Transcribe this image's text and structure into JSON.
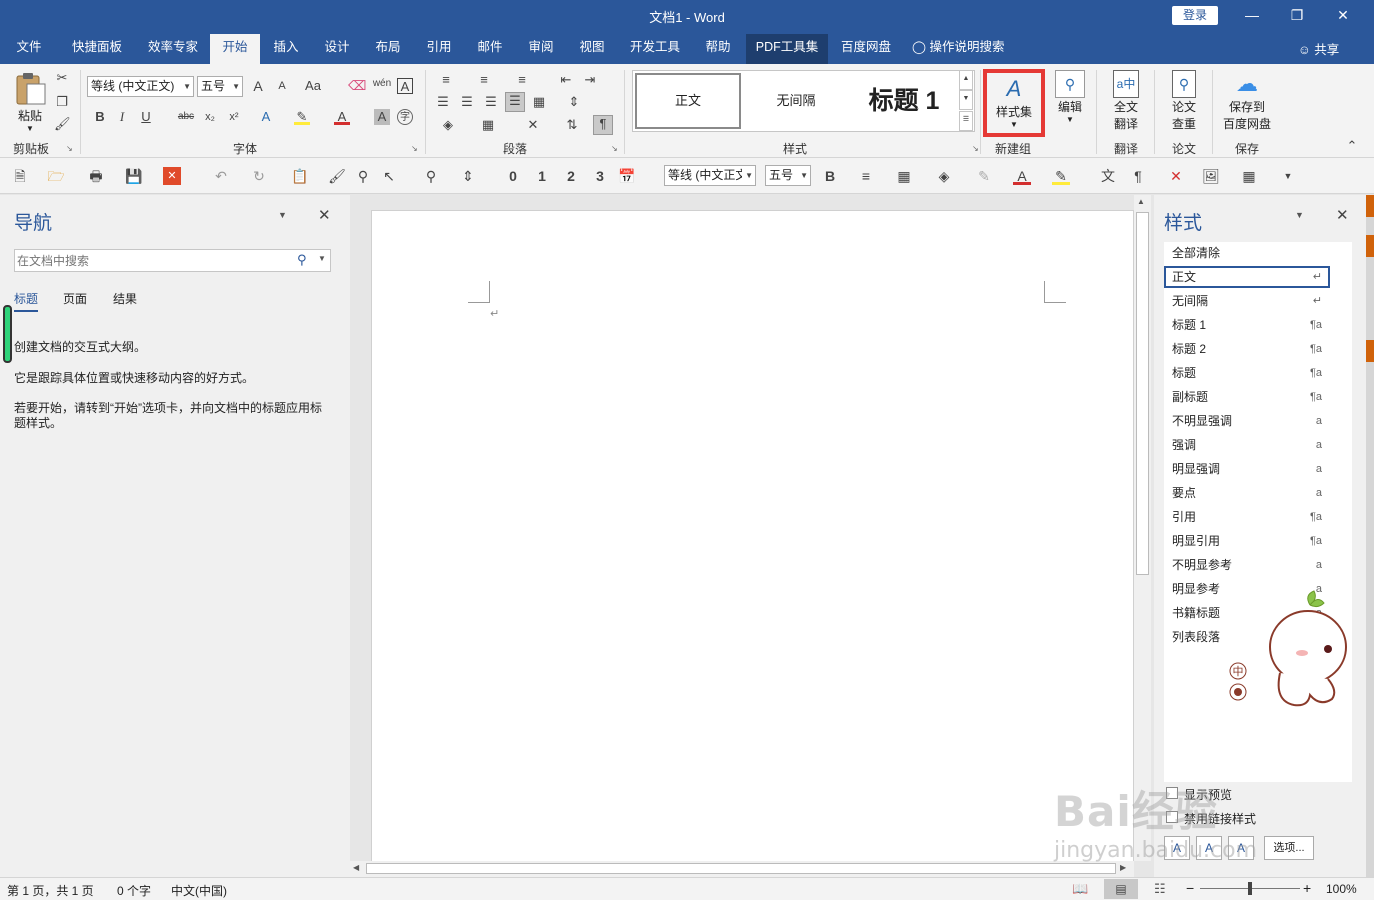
{
  "window": {
    "title": "文档1  -  Word",
    "login_label": "登录",
    "minimize": "—",
    "restore": "❐",
    "close": "✕"
  },
  "tabs": [
    "文件",
    "快捷面板",
    "效率专家",
    "开始",
    "插入",
    "设计",
    "布局",
    "引用",
    "邮件",
    "审阅",
    "视图",
    "开发工具",
    "帮助",
    "PDF工具集",
    "百度网盘",
    "操作说明搜索"
  ],
  "active_tab": "开始",
  "share_label": "共享",
  "ribbon": {
    "clipboard": {
      "paste_label": "粘贴",
      "group_label": "剪贴板"
    },
    "font": {
      "font_name": "等线 (中文正文)",
      "font_size": "五号",
      "group_label": "字体",
      "bold": "B",
      "italic": "I",
      "underline": "U",
      "strike": "abc",
      "sub": "x₂",
      "sup": "x²",
      "grow": "A",
      "shrink": "A",
      "case": "Aa",
      "phonetic": "wén",
      "border_char": "A",
      "shade_char": "A",
      "enclose": "字"
    },
    "paragraph": {
      "group_label": "段落"
    },
    "styles": {
      "items": [
        "正文",
        "无间隔",
        "标题 1"
      ],
      "group_label": "样式"
    },
    "new_group": {
      "style_set_label": "样式集",
      "edit_label": "编辑",
      "group_label": "新建组"
    },
    "translate": {
      "label_line1": "全文",
      "label_line2": "翻译",
      "group_label": "翻译"
    },
    "paper": {
      "label_line1": "论文",
      "label_line2": "查重",
      "group_label": "论文"
    },
    "save": {
      "label_line1": "保存到",
      "label_line2": "百度网盘",
      "group_label": "保存"
    },
    "highlight_color": "#e53935"
  },
  "qat": {
    "levels": [
      "0",
      "1",
      "2",
      "3"
    ],
    "font_name": "等线 (中文正文)",
    "font_size": "五号",
    "bold": "B"
  },
  "nav_pane": {
    "title": "导航",
    "search_placeholder": "在文档中搜索",
    "tabs": [
      "标题",
      "页面",
      "结果"
    ],
    "active_tab": "标题",
    "hints": [
      "创建文档的交互式大纲。",
      "它是跟踪具体位置或快速移动内容的好方式。",
      "若要开始，请转到“开始”选项卡，并向文档中的标题应用标题样式。"
    ]
  },
  "styles_pane": {
    "title": "样式",
    "items": [
      {
        "name": "全部清除",
        "mark": ""
      },
      {
        "name": "正文",
        "mark": "↵"
      },
      {
        "name": "无间隔",
        "mark": "↵"
      },
      {
        "name": "标题 1",
        "mark": "¶a"
      },
      {
        "name": "标题 2",
        "mark": "¶a"
      },
      {
        "name": "标题",
        "mark": "¶a"
      },
      {
        "name": "副标题",
        "mark": "¶a"
      },
      {
        "name": "不明显强调",
        "mark": "a"
      },
      {
        "name": "强调",
        "mark": "a"
      },
      {
        "name": "明显强调",
        "mark": "a"
      },
      {
        "name": "要点",
        "mark": "a"
      },
      {
        "name": "引用",
        "mark": "¶a"
      },
      {
        "name": "明显引用",
        "mark": "¶a"
      },
      {
        "name": "不明显参考",
        "mark": "a"
      },
      {
        "name": "明显参考",
        "mark": "a"
      },
      {
        "name": "书籍标题",
        "mark": "a"
      },
      {
        "name": "列表段落",
        "mark": "¶a"
      }
    ],
    "selected": "正文",
    "show_preview": "显示预览",
    "disable_linked": "禁用链接样式",
    "options_label": "选项..."
  },
  "ime": {
    "mode": "中",
    "cursor_mark": "↵"
  },
  "statusbar": {
    "page": "第 1 页，共 1 页",
    "words": "0 个字",
    "language": "中文(中国)",
    "zoom": "100%",
    "zoom_level": 1.0
  },
  "watermark": {
    "line1": "Bai经验",
    "line2": "jingyan.baidu.com"
  },
  "colors": {
    "brand": "#2b579a",
    "highlight_box": "#e53935"
  }
}
